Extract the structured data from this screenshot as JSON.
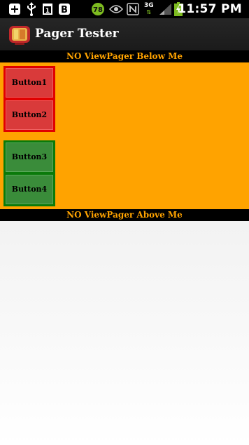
{
  "status_bar": {
    "time": "11:57 PM",
    "badge_number": "78",
    "network_label": "3G",
    "icons": [
      "add-notification-icon",
      "usb-icon",
      "calendar-icon",
      "b-app-icon",
      "eye-icon",
      "nfc-icon",
      "signal-icon",
      "battery-icon"
    ]
  },
  "action_bar": {
    "title": "Pager Tester",
    "icon": "tv-app-icon"
  },
  "banners": {
    "top": "NO ViewPager Below Me",
    "bottom": "NO ViewPager Above Me"
  },
  "buttons": {
    "b1": "Button1",
    "b2": "Button2",
    "b3": "Button3",
    "b4": "Button4"
  },
  "colors": {
    "orange": "#ffa300",
    "red_group": "#e00000",
    "green_group": "#0a7a0a"
  }
}
